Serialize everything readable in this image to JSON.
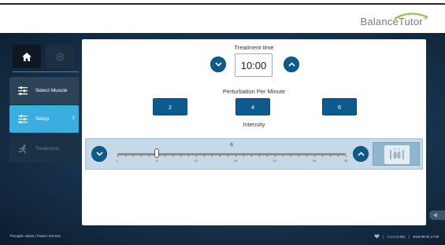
{
  "brand": {
    "name": "BalanceTutor",
    "mark": "™"
  },
  "sidebar": {
    "items": [
      {
        "label": "Select Muscle",
        "icon": "sliders-icon"
      },
      {
        "label": "Setup",
        "icon": "sliders-icon"
      },
      {
        "label": "Treatment",
        "icon": "runner-icon"
      }
    ]
  },
  "treatment_time": {
    "title": "Treatment time",
    "value": "10:00"
  },
  "perturbation": {
    "title": "Perturbation Per Minute",
    "options": [
      "2",
      "4",
      "6"
    ],
    "selected": "4"
  },
  "intensity": {
    "title": "Intensity",
    "value": "6",
    "min": 1,
    "max": 30,
    "tick_labels": [
      "1",
      "6",
      "11",
      "16",
      "21",
      "26",
      "30"
    ]
  },
  "footer": {
    "user": "Therapist: admin  |  Patient: test test",
    "version": "V.1.0.14.001",
    "datetime": "2018-09-02 17:09"
  },
  "colors": {
    "accent": "#3aaee0",
    "button": "#0c5a8e",
    "panel": "#ffffff",
    "background": "#193652"
  }
}
